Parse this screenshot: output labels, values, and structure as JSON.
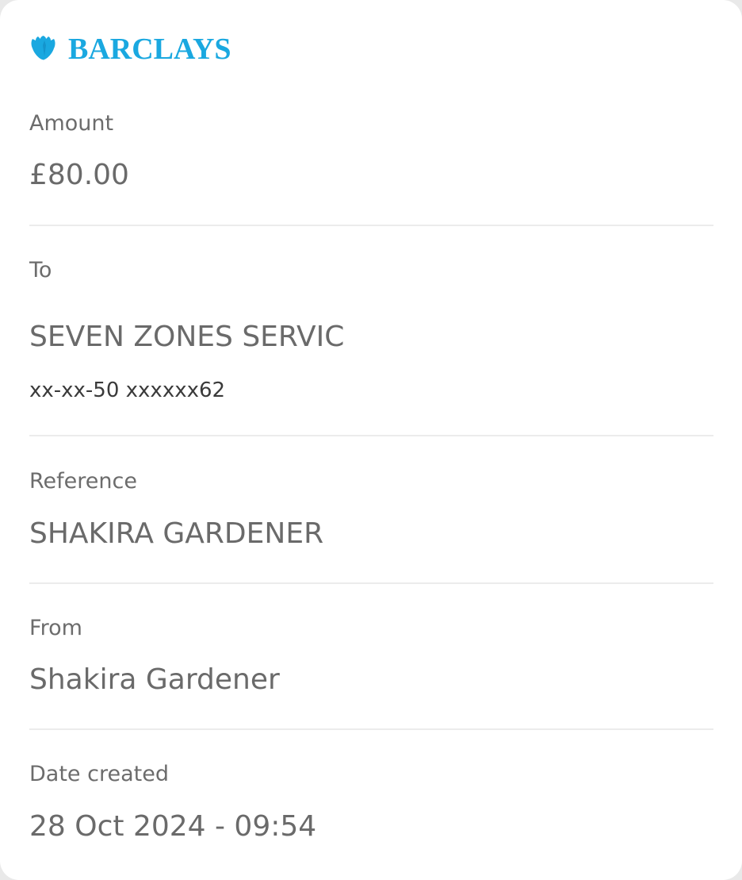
{
  "brand": {
    "name": "BARCLAYS",
    "color": "#1aa8e0",
    "icon": "eagle-icon"
  },
  "fields": {
    "amount": {
      "label": "Amount",
      "value": "£80.00"
    },
    "to": {
      "label": "To",
      "value": "SEVEN ZONES SERVIC",
      "account": "xx-xx-50 xxxxxx62"
    },
    "reference": {
      "label": "Reference",
      "value": "SHAKIRA GARDENER"
    },
    "from": {
      "label": "From",
      "value": "Shakira Gardener"
    },
    "date_created": {
      "label": "Date created",
      "value": "28 Oct 2024 - 09:54"
    }
  }
}
